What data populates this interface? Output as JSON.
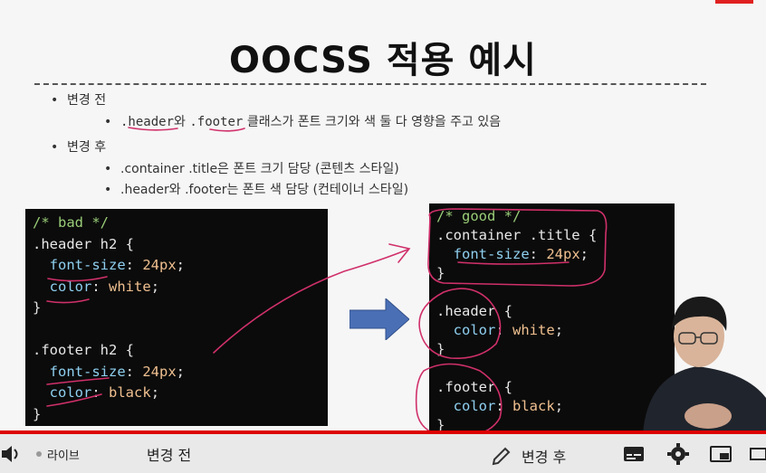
{
  "slide": {
    "title": "OOCSS 적용 예시",
    "before_heading": "변경 전",
    "before_item_code1": ".header",
    "before_item_mid": "와 ",
    "before_item_code2": ".footer",
    "before_item_rest": " 클래스가 폰트 크기와 색 둘 다 영향을 주고 있음",
    "after_heading": "변경 후",
    "after_item1": ".container .title은 폰트 크기 담당 (콘텐츠 스타일)",
    "after_item2": ".header와 .footer는 폰트 색 담당 (컨테이너 스타일)"
  },
  "code_bad": {
    "comment": "/* bad */",
    "header_sel": ".header h2 {",
    "fs_prop": "font-size",
    "fs_val": "24px",
    "color_prop": "color",
    "white_val": "white",
    "close": "}",
    "footer_sel": ".footer h2 {",
    "black_val": "black"
  },
  "code_good": {
    "comment": "/* good */",
    "container_sel": ".container .title {",
    "fs_prop": "font-size",
    "fs_val": "24px",
    "close": "}",
    "header_sel": ".header {",
    "color_prop": "color",
    "white_val": "white",
    "footer_sel": ".footer {",
    "black_val": "black"
  },
  "player": {
    "live_label": "라이브",
    "caption_left": "변경 전",
    "caption_right": "변경 후",
    "icons": [
      "volume-icon",
      "pencil-icon",
      "subtitles-icon",
      "settings-icon",
      "miniplayer-icon",
      "theater-icon"
    ],
    "progress_color": "#dd0000"
  }
}
